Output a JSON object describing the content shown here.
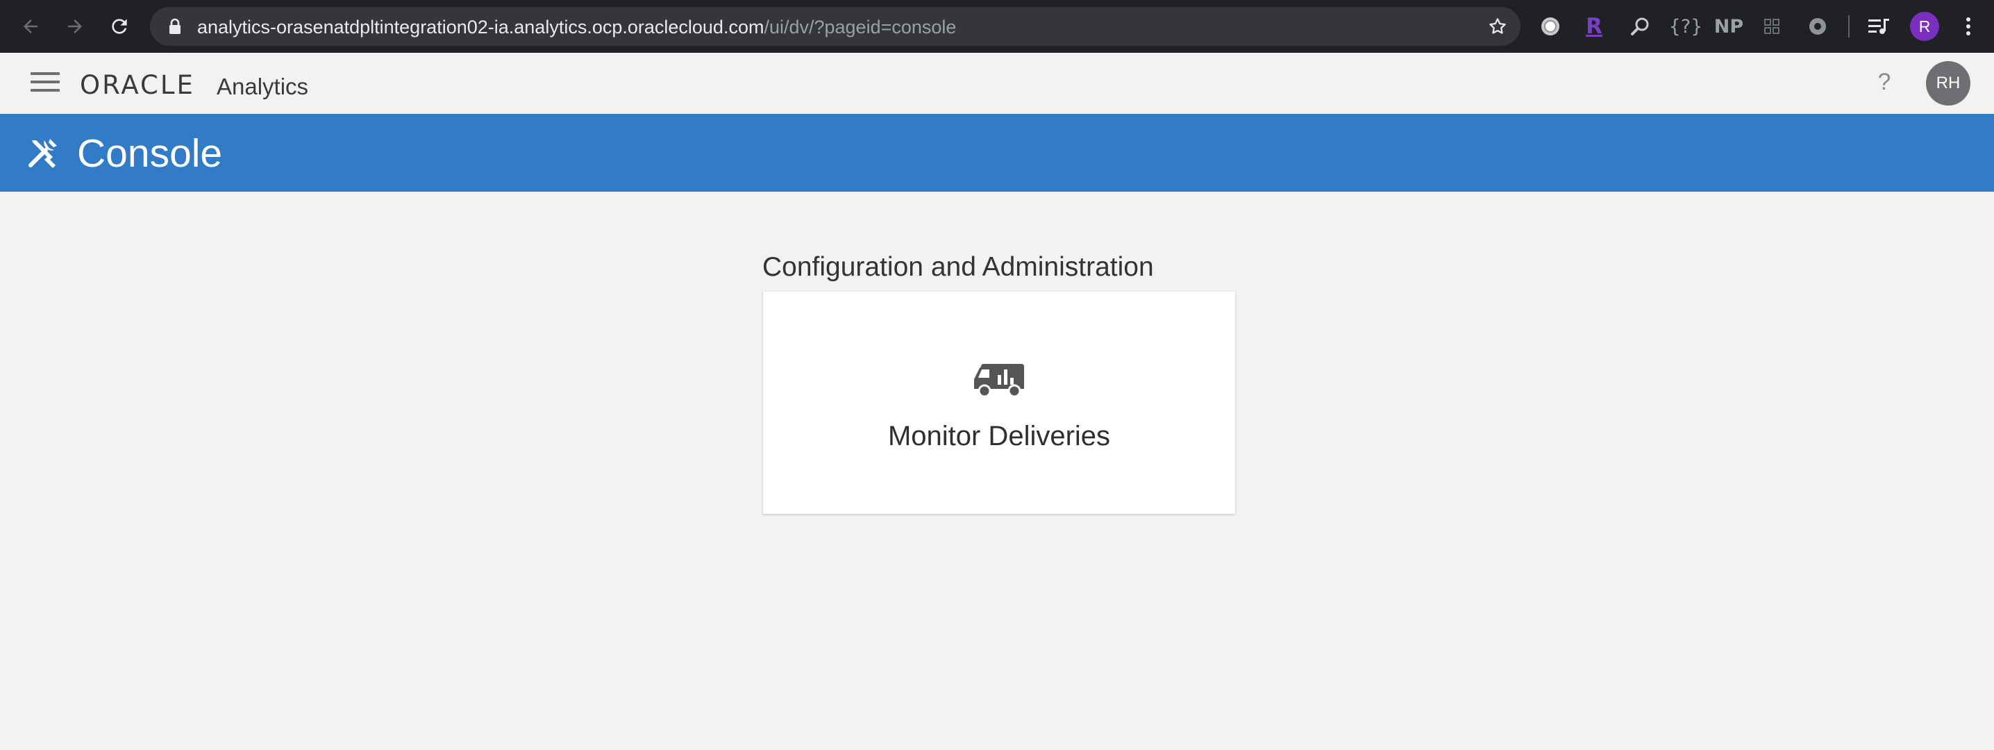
{
  "browser": {
    "url_host": "analytics-orasenatdpltintegration02-ia.analytics.ocp.oraclecloud.com",
    "url_path": "/ui/dv/?pageid=console",
    "ext_query_label": "{?}",
    "ext_np_label": "NP",
    "ext_r_label": "R",
    "profile_initial": "R"
  },
  "header": {
    "logo_text": "ORACLE",
    "product_name": "Analytics",
    "help_label": "?",
    "user_initials": "RH"
  },
  "banner": {
    "title": "Console",
    "color": "#327cc7"
  },
  "content": {
    "section_title": "Configuration and Administration",
    "cards": [
      {
        "label": "Monitor Deliveries",
        "icon": "delivery-truck-icon"
      }
    ]
  }
}
